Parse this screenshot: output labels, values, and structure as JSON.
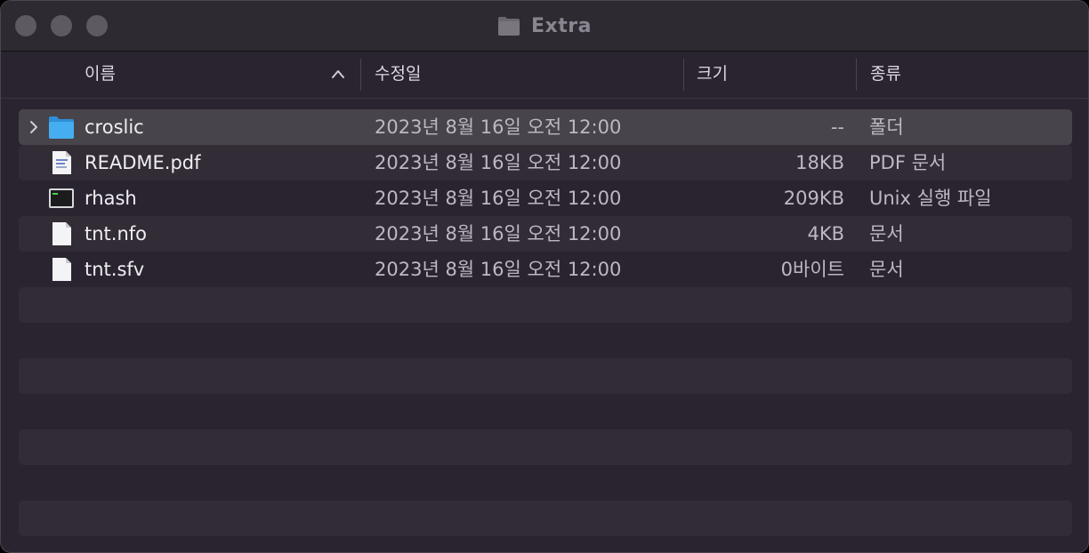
{
  "window": {
    "title": "Extra"
  },
  "columns": {
    "name": "이름",
    "date": "수정일",
    "size": "크기",
    "kind": "종류"
  },
  "files": [
    {
      "name": "croslic",
      "date": "2023년 8월 16일 오전 12:00",
      "size": "--",
      "kind": "폴더",
      "icon": "folder-icon",
      "selected": true
    },
    {
      "name": "README.pdf",
      "date": "2023년 8월 16일 오전 12:00",
      "size": "18KB",
      "kind": "PDF 문서",
      "icon": "pdf-file-icon"
    },
    {
      "name": "rhash",
      "date": "2023년 8월 16일 오전 12:00",
      "size": "209KB",
      "kind": "Unix 실행 파일",
      "icon": "terminal-exec-icon"
    },
    {
      "name": "tnt.nfo",
      "date": "2023년 8월 16일 오전 12:00",
      "size": "4KB",
      "kind": "문서",
      "icon": "document-icon"
    },
    {
      "name": "tnt.sfv",
      "date": "2023년 8월 16일 오전 12:00",
      "size": "0바이트",
      "kind": "문서",
      "icon": "document-icon"
    }
  ],
  "colors": {
    "window_bg": "#2a2430",
    "row_alt": "#322c37",
    "row_selected": "#48444b",
    "folder_blue": "#3aa0e8"
  }
}
